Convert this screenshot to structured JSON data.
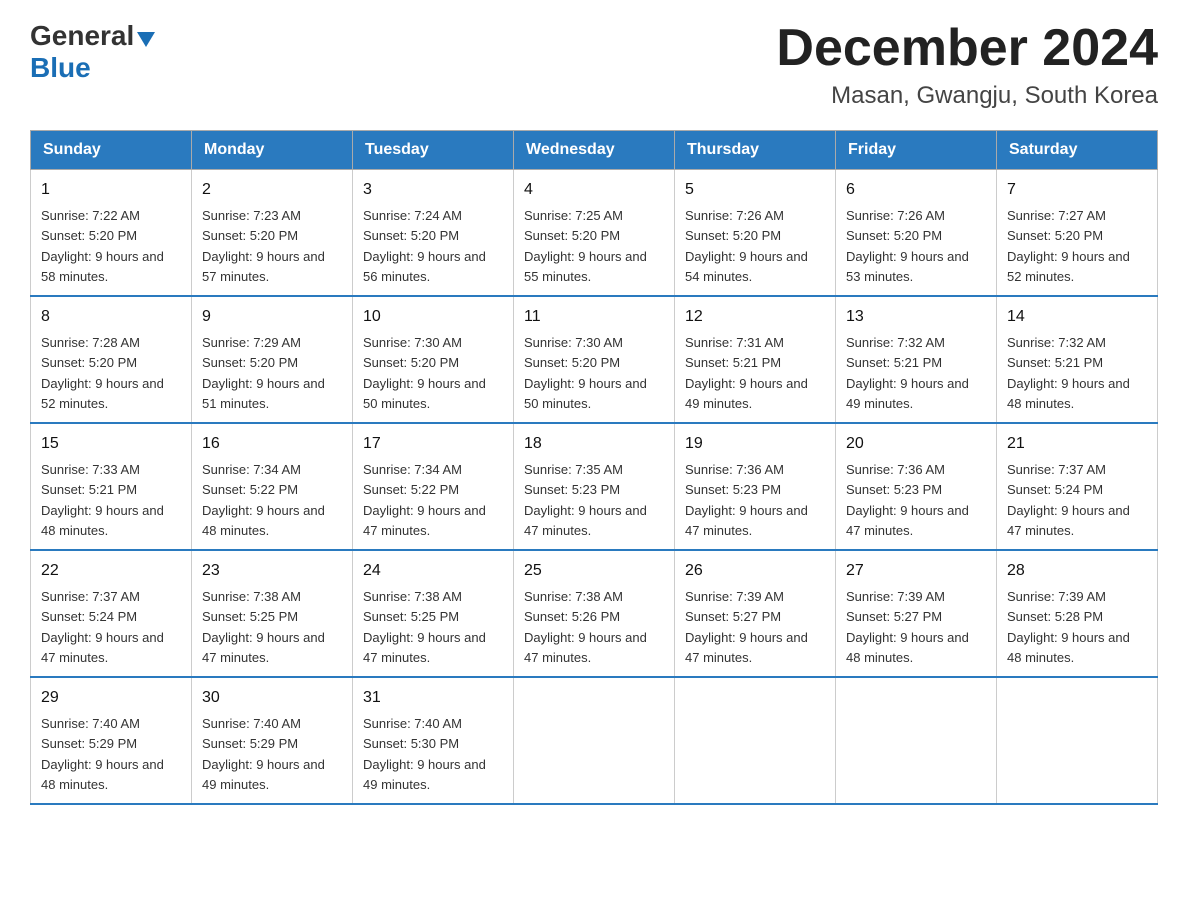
{
  "logo": {
    "general": "General",
    "triangle": "▶",
    "blue": "Blue"
  },
  "title": "December 2024",
  "subtitle": "Masan, Gwangju, South Korea",
  "weekdays": [
    "Sunday",
    "Monday",
    "Tuesday",
    "Wednesday",
    "Thursday",
    "Friday",
    "Saturday"
  ],
  "weeks": [
    [
      {
        "day": "1",
        "sunrise": "7:22 AM",
        "sunset": "5:20 PM",
        "daylight": "9 hours and 58 minutes."
      },
      {
        "day": "2",
        "sunrise": "7:23 AM",
        "sunset": "5:20 PM",
        "daylight": "9 hours and 57 minutes."
      },
      {
        "day": "3",
        "sunrise": "7:24 AM",
        "sunset": "5:20 PM",
        "daylight": "9 hours and 56 minutes."
      },
      {
        "day": "4",
        "sunrise": "7:25 AM",
        "sunset": "5:20 PM",
        "daylight": "9 hours and 55 minutes."
      },
      {
        "day": "5",
        "sunrise": "7:26 AM",
        "sunset": "5:20 PM",
        "daylight": "9 hours and 54 minutes."
      },
      {
        "day": "6",
        "sunrise": "7:26 AM",
        "sunset": "5:20 PM",
        "daylight": "9 hours and 53 minutes."
      },
      {
        "day": "7",
        "sunrise": "7:27 AM",
        "sunset": "5:20 PM",
        "daylight": "9 hours and 52 minutes."
      }
    ],
    [
      {
        "day": "8",
        "sunrise": "7:28 AM",
        "sunset": "5:20 PM",
        "daylight": "9 hours and 52 minutes."
      },
      {
        "day": "9",
        "sunrise": "7:29 AM",
        "sunset": "5:20 PM",
        "daylight": "9 hours and 51 minutes."
      },
      {
        "day": "10",
        "sunrise": "7:30 AM",
        "sunset": "5:20 PM",
        "daylight": "9 hours and 50 minutes."
      },
      {
        "day": "11",
        "sunrise": "7:30 AM",
        "sunset": "5:20 PM",
        "daylight": "9 hours and 50 minutes."
      },
      {
        "day": "12",
        "sunrise": "7:31 AM",
        "sunset": "5:21 PM",
        "daylight": "9 hours and 49 minutes."
      },
      {
        "day": "13",
        "sunrise": "7:32 AM",
        "sunset": "5:21 PM",
        "daylight": "9 hours and 49 minutes."
      },
      {
        "day": "14",
        "sunrise": "7:32 AM",
        "sunset": "5:21 PM",
        "daylight": "9 hours and 48 minutes."
      }
    ],
    [
      {
        "day": "15",
        "sunrise": "7:33 AM",
        "sunset": "5:21 PM",
        "daylight": "9 hours and 48 minutes."
      },
      {
        "day": "16",
        "sunrise": "7:34 AM",
        "sunset": "5:22 PM",
        "daylight": "9 hours and 48 minutes."
      },
      {
        "day": "17",
        "sunrise": "7:34 AM",
        "sunset": "5:22 PM",
        "daylight": "9 hours and 47 minutes."
      },
      {
        "day": "18",
        "sunrise": "7:35 AM",
        "sunset": "5:23 PM",
        "daylight": "9 hours and 47 minutes."
      },
      {
        "day": "19",
        "sunrise": "7:36 AM",
        "sunset": "5:23 PM",
        "daylight": "9 hours and 47 minutes."
      },
      {
        "day": "20",
        "sunrise": "7:36 AM",
        "sunset": "5:23 PM",
        "daylight": "9 hours and 47 minutes."
      },
      {
        "day": "21",
        "sunrise": "7:37 AM",
        "sunset": "5:24 PM",
        "daylight": "9 hours and 47 minutes."
      }
    ],
    [
      {
        "day": "22",
        "sunrise": "7:37 AM",
        "sunset": "5:24 PM",
        "daylight": "9 hours and 47 minutes."
      },
      {
        "day": "23",
        "sunrise": "7:38 AM",
        "sunset": "5:25 PM",
        "daylight": "9 hours and 47 minutes."
      },
      {
        "day": "24",
        "sunrise": "7:38 AM",
        "sunset": "5:25 PM",
        "daylight": "9 hours and 47 minutes."
      },
      {
        "day": "25",
        "sunrise": "7:38 AM",
        "sunset": "5:26 PM",
        "daylight": "9 hours and 47 minutes."
      },
      {
        "day": "26",
        "sunrise": "7:39 AM",
        "sunset": "5:27 PM",
        "daylight": "9 hours and 47 minutes."
      },
      {
        "day": "27",
        "sunrise": "7:39 AM",
        "sunset": "5:27 PM",
        "daylight": "9 hours and 48 minutes."
      },
      {
        "day": "28",
        "sunrise": "7:39 AM",
        "sunset": "5:28 PM",
        "daylight": "9 hours and 48 minutes."
      }
    ],
    [
      {
        "day": "29",
        "sunrise": "7:40 AM",
        "sunset": "5:29 PM",
        "daylight": "9 hours and 48 minutes."
      },
      {
        "day": "30",
        "sunrise": "7:40 AM",
        "sunset": "5:29 PM",
        "daylight": "9 hours and 49 minutes."
      },
      {
        "day": "31",
        "sunrise": "7:40 AM",
        "sunset": "5:30 PM",
        "daylight": "9 hours and 49 minutes."
      },
      null,
      null,
      null,
      null
    ]
  ]
}
